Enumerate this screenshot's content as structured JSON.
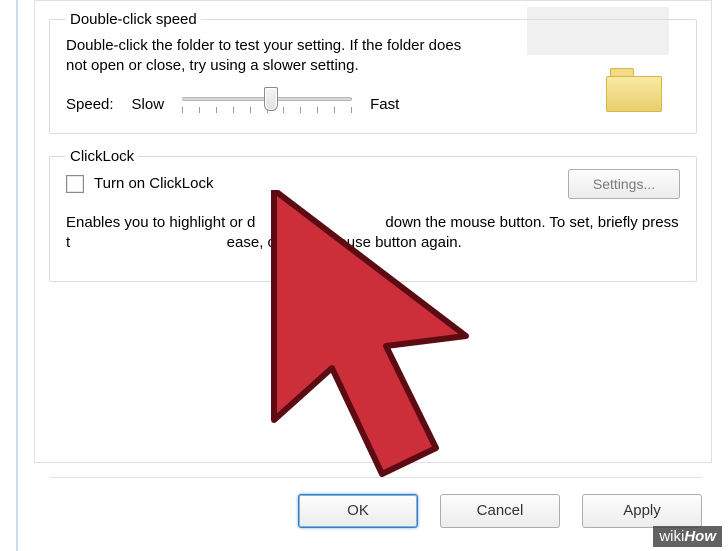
{
  "doubleClick": {
    "legend": "Double-click speed",
    "description": "Double-click the folder to test your setting. If the folder does not open or close, try using a slower setting.",
    "speedLabel": "Speed:",
    "slowLabel": "Slow",
    "fastLabel": "Fast"
  },
  "clickLock": {
    "legend": "ClickLock",
    "checkboxLabel": "Turn on ClickLock",
    "settingsButton": "Settings...",
    "descriptionA": "Enables you to highlight or d",
    "descriptionB": " down the mouse button. To set, briefly press t",
    "descriptionC": "ease, click the mouse button again."
  },
  "dialogButtons": {
    "ok": "OK",
    "cancel": "Cancel",
    "apply": "Apply"
  },
  "watermark": {
    "a": "wiki",
    "b": "How"
  }
}
